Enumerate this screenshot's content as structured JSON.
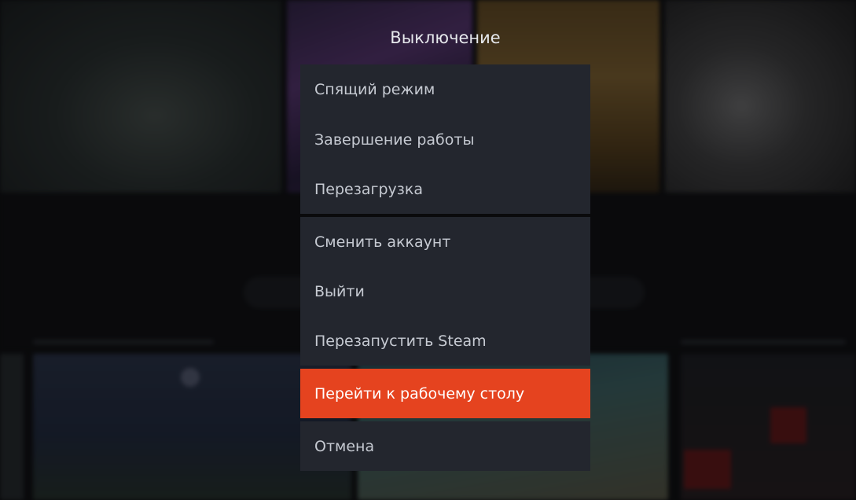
{
  "dialog": {
    "title": "Выключение",
    "groups": [
      {
        "items": [
          {
            "label": "Спящий режим"
          },
          {
            "label": "Завершение работы"
          },
          {
            "label": "Перезагрузка"
          }
        ]
      },
      {
        "items": [
          {
            "label": "Сменить аккаунт"
          },
          {
            "label": "Выйти"
          },
          {
            "label": "Перезапустить Steam"
          }
        ]
      },
      {
        "items": [
          {
            "label": "Перейти к рабочему столу",
            "selected": true
          }
        ]
      },
      {
        "items": [
          {
            "label": "Отмена"
          }
        ]
      }
    ]
  },
  "colors": {
    "highlight": "#e5431f",
    "menu_background": "#23262e",
    "menu_text": "#c6cad2"
  }
}
